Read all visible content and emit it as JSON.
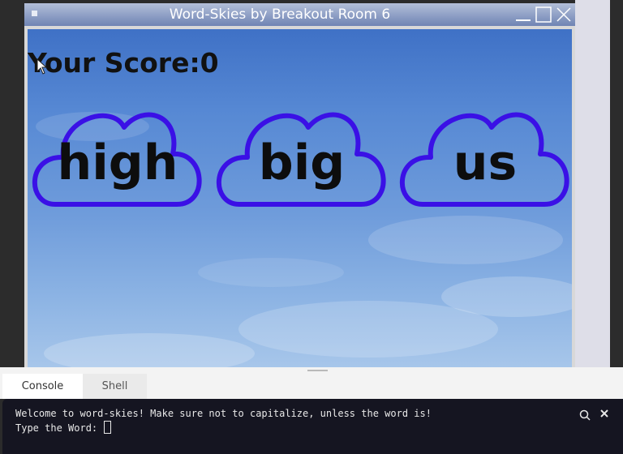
{
  "window": {
    "title": "Word-Skies by Breakout Room 6"
  },
  "game": {
    "score_label": "Your Score:0",
    "words": [
      "high",
      "big",
      "us"
    ],
    "cloud_color": "#3a10e6",
    "sky_color": "#5789d4"
  },
  "console_panel": {
    "tabs": [
      {
        "label": "Console",
        "active": true
      },
      {
        "label": "Shell",
        "active": false
      }
    ],
    "lines": [
      "Welcome to word-skies! Make sure not to capitalize, unless the word is!",
      "Type the Word: "
    ],
    "icons": [
      "search-icon",
      "close-icon"
    ]
  }
}
